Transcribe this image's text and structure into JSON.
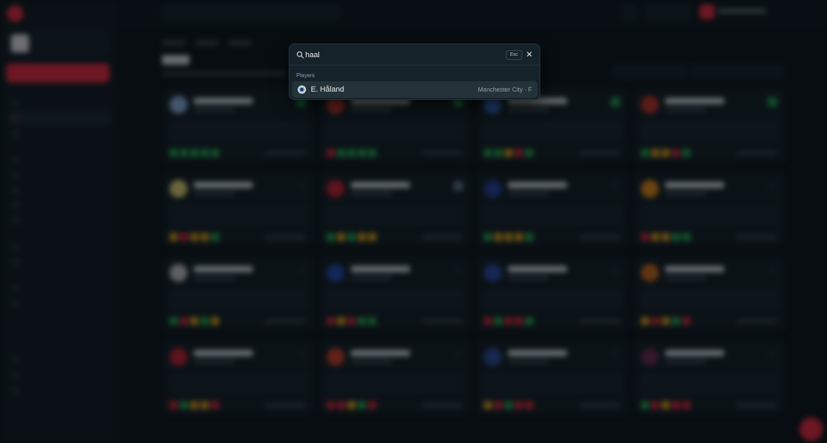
{
  "search_dialog": {
    "query": "haal",
    "esc_label": "Esc",
    "close_glyph": "✕",
    "section_label": "Players",
    "results": [
      {
        "name": "E. Håland",
        "club": "Manchester City",
        "separator": "·",
        "position": "F"
      }
    ]
  },
  "background": {
    "cards": [
      {
        "crest": "#8fb3e0",
        "tag": "#1f9d4a",
        "form": [
          "#22a84e",
          "#22a84e",
          "#22a84e",
          "#22a84e",
          "#22a84e"
        ]
      },
      {
        "crest": "#d23a2a",
        "tag": "#1f9d4a",
        "form": [
          "#d8263a",
          "#22a84e",
          "#22a84e",
          "#22a84e",
          "#22a84e"
        ]
      },
      {
        "crest": "#3b6fc6",
        "tag": "#1f9d4a",
        "form": [
          "#22a84e",
          "#22a84e",
          "#e0a21a",
          "#d8263a",
          "#22a84e"
        ]
      },
      {
        "crest": "#c43428",
        "tag": "#1f9d4a",
        "form": [
          "#22a84e",
          "#e0a21a",
          "#e0a21a",
          "#d8263a",
          "#22a84e"
        ]
      },
      {
        "crest": "#e5d57a",
        "tag": "#1a262c",
        "form": [
          "#e0a21a",
          "#d8263a",
          "#e0a21a",
          "#e0a21a",
          "#22a84e"
        ]
      },
      {
        "crest": "#c8202f",
        "tag": "#5d7a8a",
        "form": [
          "#22a84e",
          "#e0a21a",
          "#22a84e",
          "#e0a21a",
          "#e0a21a"
        ]
      },
      {
        "crest": "#27409a",
        "tag": "#1a262c",
        "form": [
          "#22a84e",
          "#e0a21a",
          "#e0a21a",
          "#e0a21a",
          "#22a84e"
        ]
      },
      {
        "crest": "#e58a1a",
        "tag": "#1a262c",
        "form": [
          "#d8263a",
          "#e0a21a",
          "#e0a21a",
          "#22a84e",
          "#22a84e"
        ]
      },
      {
        "crest": "#c8c8c8",
        "tag": "#1a262c",
        "form": [
          "#22a84e",
          "#d8263a",
          "#e0a21a",
          "#22a84e",
          "#e0a21a"
        ]
      },
      {
        "crest": "#1f4fb3",
        "tag": "#1a262c",
        "form": [
          "#d8263a",
          "#e0a21a",
          "#d8263a",
          "#22a84e",
          "#22a84e"
        ]
      },
      {
        "crest": "#2a4aa8",
        "tag": "#1a262c",
        "form": [
          "#d8263a",
          "#22a84e",
          "#d8263a",
          "#d8263a",
          "#22a84e"
        ]
      },
      {
        "crest": "#d36a1a",
        "tag": "#1a262c",
        "form": [
          "#e0a21a",
          "#d8263a",
          "#e0a21a",
          "#22a84e",
          "#d8263a"
        ]
      },
      {
        "crest": "#c8202f",
        "tag": "#1a262c",
        "form": [
          "#d8263a",
          "#22a84e",
          "#e0a21a",
          "#e0a21a",
          "#d8263a"
        ]
      },
      {
        "crest": "#d0402a",
        "tag": "#1a262c",
        "form": [
          "#d8263a",
          "#d8263a",
          "#e0a21a",
          "#22a84e",
          "#d8263a"
        ]
      },
      {
        "crest": "#2b4c9c",
        "tag": "#1a262c",
        "form": [
          "#e0a21a",
          "#d8263a",
          "#22a84e",
          "#d8263a",
          "#d8263a"
        ]
      },
      {
        "crest": "#6b2a4a",
        "tag": "#1a262c",
        "form": [
          "#22a84e",
          "#d8263a",
          "#e0a21a",
          "#d8263a",
          "#d8263a"
        ]
      }
    ],
    "accent": "#e8293f"
  }
}
